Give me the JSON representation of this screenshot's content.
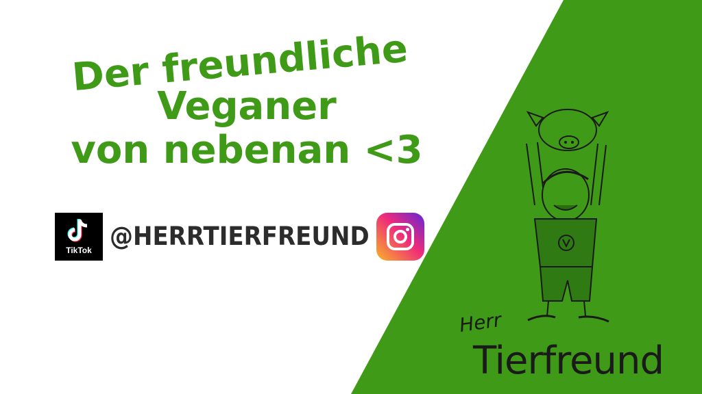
{
  "headline": {
    "line1": "Der freundliche",
    "line2": "Veganer",
    "line3": "von nebenan <3"
  },
  "socials": {
    "tiktok_label": "TikTok",
    "handle": "@HERRTIERFREUND"
  },
  "signature": {
    "line1": "Herr",
    "line2": "Tierfreund"
  },
  "colors": {
    "green": "#3e9a17",
    "text_dark": "#2c2c2c"
  },
  "icons": [
    "tiktok-icon",
    "instagram-icon",
    "character-illustration"
  ]
}
